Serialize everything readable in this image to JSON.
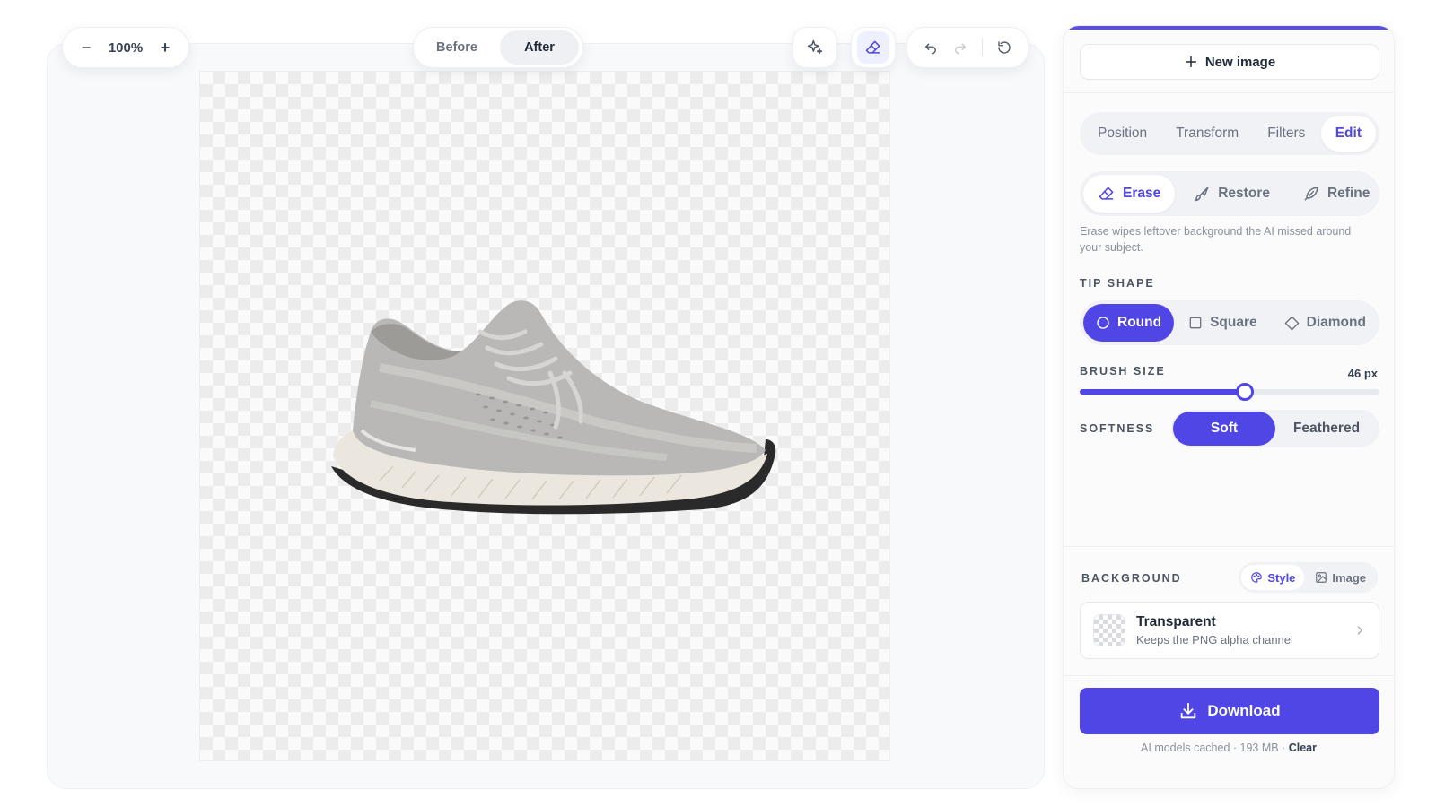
{
  "toolbar": {
    "zoom_label": "100%",
    "zoom_out_label": "−",
    "zoom_in_label": "+",
    "before_label": "Before",
    "after_label": "After",
    "active_view": "After",
    "icons": {
      "magic": "sparkles-icon",
      "eraser": "eraser-icon",
      "undo": "undo-icon",
      "redo": "redo-icon",
      "reset": "reset-icon"
    }
  },
  "panel": {
    "new_image_label": "New image",
    "tabs": [
      {
        "label": "Position",
        "active": false
      },
      {
        "label": "Transform",
        "active": false
      },
      {
        "label": "Filters",
        "active": false
      },
      {
        "label": "Edit",
        "active": true
      }
    ],
    "tools": [
      {
        "label": "Erase",
        "icon": "eraser-icon",
        "active": true
      },
      {
        "label": "Restore",
        "icon": "brush-icon",
        "active": false
      },
      {
        "label": "Refine",
        "icon": "feather-icon",
        "active": false
      }
    ],
    "hint": "Erase wipes leftover background the AI missed around your subject.",
    "tip_shape": {
      "label": "TIP SHAPE",
      "options": [
        {
          "label": "Round",
          "active": true
        },
        {
          "label": "Square",
          "active": false
        },
        {
          "label": "Diamond",
          "active": false
        }
      ]
    },
    "brush_size": {
      "label": "BRUSH SIZE",
      "value_text": "46 px",
      "fraction": 0.55
    },
    "softness": {
      "label": "SOFTNESS",
      "options": [
        {
          "label": "Soft",
          "active": true
        },
        {
          "label": "Feathered",
          "active": false
        }
      ]
    },
    "background": {
      "label": "BACKGROUND",
      "style_label": "Style",
      "image_label": "Image",
      "title": "Transparent",
      "subtitle": "Keeps the PNG alpha channel"
    },
    "download_label": "Download",
    "footer_text": "AI models cached · 193 MB · ",
    "clear_label": "Clear"
  },
  "colors": {
    "accent": "#4f46e5",
    "panel_bg": "#fbfbfc",
    "stage_bg": "#f8f9fb"
  }
}
